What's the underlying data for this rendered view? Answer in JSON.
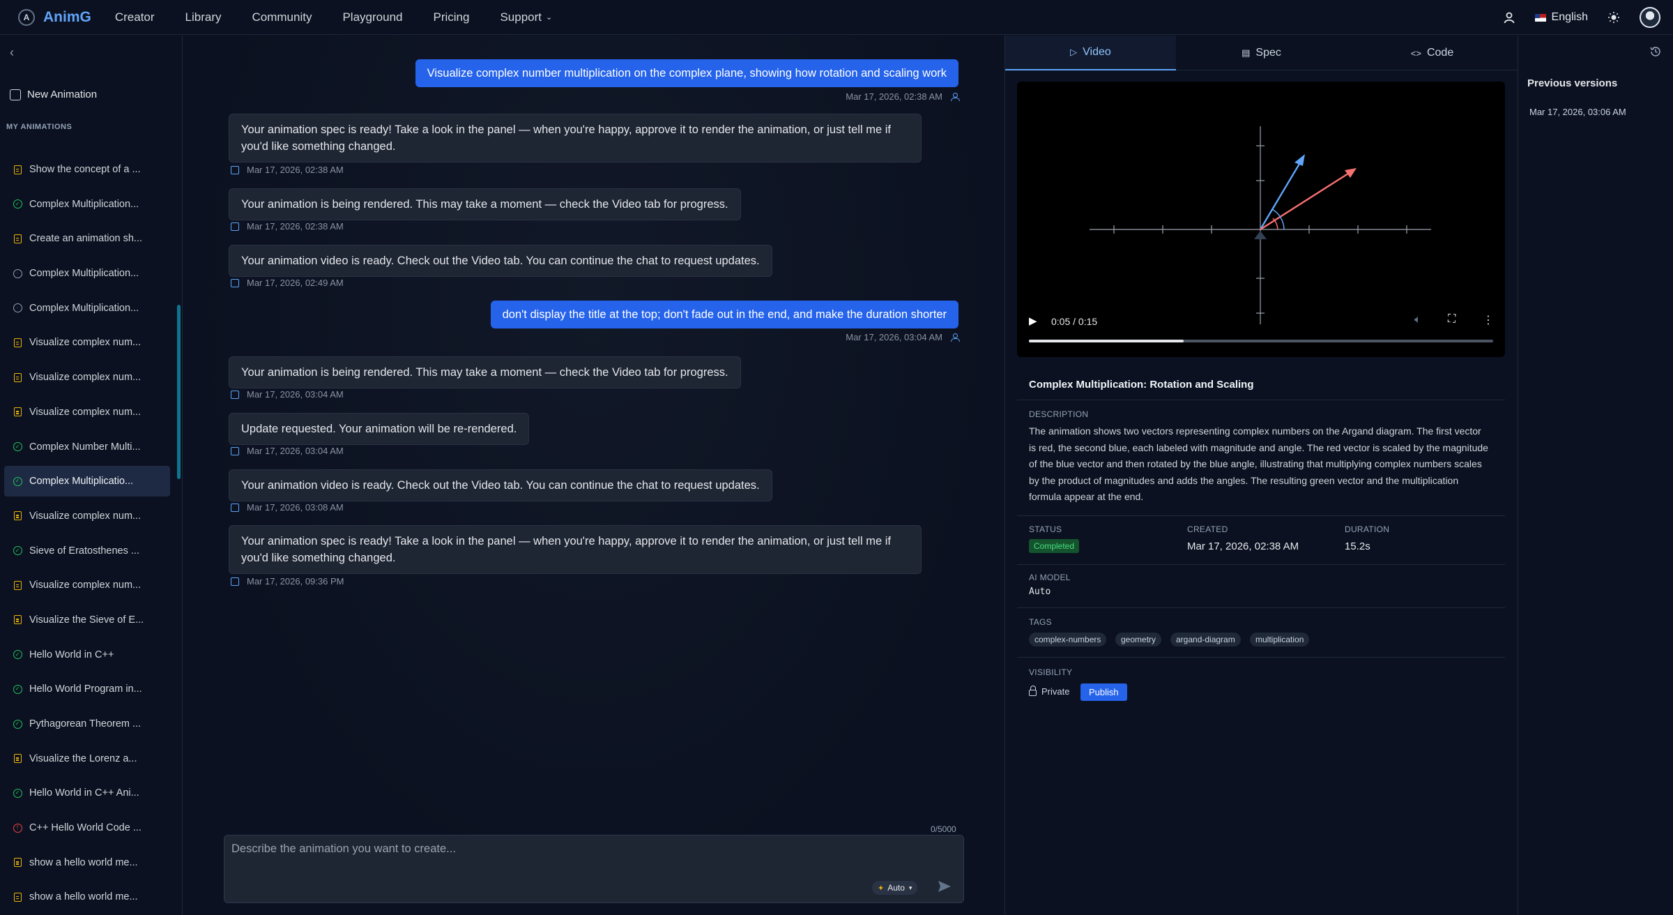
{
  "app": {
    "name": "AnimG",
    "logo_letter": "A",
    "nav": [
      "Creator",
      "Library",
      "Community",
      "Playground",
      "Pricing",
      "Support"
    ],
    "language": "English"
  },
  "sidebar": {
    "new_animation": "New Animation",
    "section_label": "MY ANIMATIONS",
    "items": [
      {
        "label": "Show the concept of a ...",
        "status": "spec"
      },
      {
        "label": "Complex Multiplication...",
        "status": "done"
      },
      {
        "label": "Create an animation sh...",
        "status": "spec"
      },
      {
        "label": "Complex Multiplication...",
        "status": "clock"
      },
      {
        "label": "Complex Multiplication...",
        "status": "clock"
      },
      {
        "label": "Visualize complex num...",
        "status": "spec"
      },
      {
        "label": "Visualize complex num...",
        "status": "spec"
      },
      {
        "label": "Visualize complex num...",
        "status": "spec"
      },
      {
        "label": "Complex Number Multi...",
        "status": "done"
      },
      {
        "label": "Complex Multiplicatio...",
        "status": "done",
        "active": true
      },
      {
        "label": "Visualize complex num...",
        "status": "spec"
      },
      {
        "label": "Sieve of Eratosthenes ...",
        "status": "done"
      },
      {
        "label": "Visualize complex num...",
        "status": "spec"
      },
      {
        "label": "Visualize the Sieve of E...",
        "status": "spec"
      },
      {
        "label": "Hello World in C++",
        "status": "done"
      },
      {
        "label": "Hello World Program in...",
        "status": "done"
      },
      {
        "label": "Pythagorean Theorem ...",
        "status": "done"
      },
      {
        "label": "Visualize the Lorenz a...",
        "status": "spec"
      },
      {
        "label": "Hello World in C++ Ani...",
        "status": "done"
      },
      {
        "label": "C++ Hello World Code ...",
        "status": "error"
      },
      {
        "label": "show a hello world me...",
        "status": "spec"
      },
      {
        "label": "show a hello world me...",
        "status": "spec"
      }
    ]
  },
  "chat": {
    "messages": [
      {
        "role": "user",
        "text": "Visualize complex number multiplication on the complex plane, showing how rotation and scaling work",
        "time": "Mar 17, 2026, 02:38 AM"
      },
      {
        "role": "ai",
        "text": "Your animation spec is ready! Take a look in the panel — when you're happy, approve it to render the animation, or just tell me if you'd like something changed.",
        "time": "Mar 17, 2026, 02:38 AM"
      },
      {
        "role": "ai",
        "text": "Your animation is being rendered. This may take a moment — check the Video tab for progress.",
        "time": "Mar 17, 2026, 02:38 AM"
      },
      {
        "role": "ai",
        "text": "Your animation video is ready. Check out the Video tab. You can continue the chat to request updates.",
        "time": "Mar 17, 2026, 02:49 AM"
      },
      {
        "role": "user",
        "text": "don't display the title at the top; don't fade out in the end, and make the duration shorter",
        "time": "Mar 17, 2026, 03:04 AM"
      },
      {
        "role": "ai",
        "text": "Your animation is being rendered. This may take a moment — check the Video tab for progress.",
        "time": "Mar 17, 2026, 03:04 AM"
      },
      {
        "role": "ai",
        "text": "Update requested. Your animation will be re-rendered.",
        "time": "Mar 17, 2026, 03:04 AM"
      },
      {
        "role": "ai",
        "text": "Your animation video is ready. Check out the Video tab. You can continue the chat to request updates.",
        "time": "Mar 17, 2026, 03:08 AM"
      },
      {
        "role": "ai",
        "text": "Your animation spec is ready! Take a look in the panel — when you're happy, approve it to render the animation, or just tell me if you'd like something changed.",
        "time": "Mar 17, 2026, 09:36 PM"
      }
    ],
    "counter": "0/5000",
    "input_placeholder": "Describe the animation you want to create...",
    "model": "Auto"
  },
  "panel": {
    "tabs": [
      "Video",
      "Spec",
      "Code"
    ],
    "active_tab": "Video",
    "video": {
      "time": "0:05 / 0:15",
      "progress": 0.333
    },
    "title": "Complex Multiplication: Rotation and Scaling",
    "description_label": "DESCRIPTION",
    "description": "The animation shows two vectors representing complex numbers on the Argand diagram. The first vector is red, the second blue, each labeled with magnitude and angle. The red vector is scaled by the magnitude of the blue vector and then rotated by the blue angle, illustrating that multiplying complex numbers scales by the product of magnitudes and adds the angles. The resulting green vector and the multiplication formula appear at the end.",
    "status_label": "STATUS",
    "status": "Completed",
    "created_label": "CREATED",
    "created": "Mar 17, 2026, 02:38 AM",
    "duration_label": "DURATION",
    "duration": "15.2s",
    "model_label": "AI MODEL",
    "model": "Auto",
    "tags_label": "TAGS",
    "tags": [
      "complex-numbers",
      "geometry",
      "argand-diagram",
      "multiplication"
    ],
    "visibility_label": "VISIBILITY",
    "visibility": "Private",
    "publish": "Publish",
    "colors": {
      "accent": "#2563eb",
      "success": "#4ade80",
      "red_vector": "#f87171",
      "blue_vector": "#60a5fa"
    }
  },
  "versions": {
    "title": "Previous versions",
    "items": [
      "Mar 17, 2026, 03:06 AM"
    ]
  }
}
